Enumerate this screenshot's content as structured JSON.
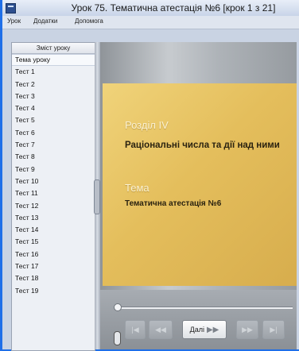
{
  "window": {
    "title": "Урок 75. Тематична атестація №6 [крок 1 з 21]"
  },
  "menu": [
    "Урок",
    "Додатки",
    "Допомога"
  ],
  "sidebar": {
    "header": "Зміст уроку",
    "items": [
      "Тема уроку",
      "Тест 1",
      "Тест 2",
      "Тест 3",
      "Тест 4",
      "Тест 5",
      "Тест 6",
      "Тест 7",
      "Тест 8",
      "Тест 9",
      "Тест 10",
      "Тест 11",
      "Тест 12",
      "Тест 13",
      "Тест 14",
      "Тест 15",
      "Тест 16",
      "Тест 17",
      "Тест 18",
      "Тест 19"
    ],
    "selected_index": 0
  },
  "slide": {
    "section_label": "Розділ IV",
    "section_title": "Раціональні числа та дії над ними",
    "topic_label": "Тема",
    "topic_title": "Тематична атестація №6"
  },
  "controls": {
    "next_label": "Далі",
    "progress": 0
  },
  "colors": {
    "desktop": "#1f6fe8",
    "card": "#e4be5c"
  },
  "icons": [
    "app-icon",
    "first-icon",
    "prev-icon",
    "next-icon",
    "end-icon",
    "speaker-icon"
  ]
}
